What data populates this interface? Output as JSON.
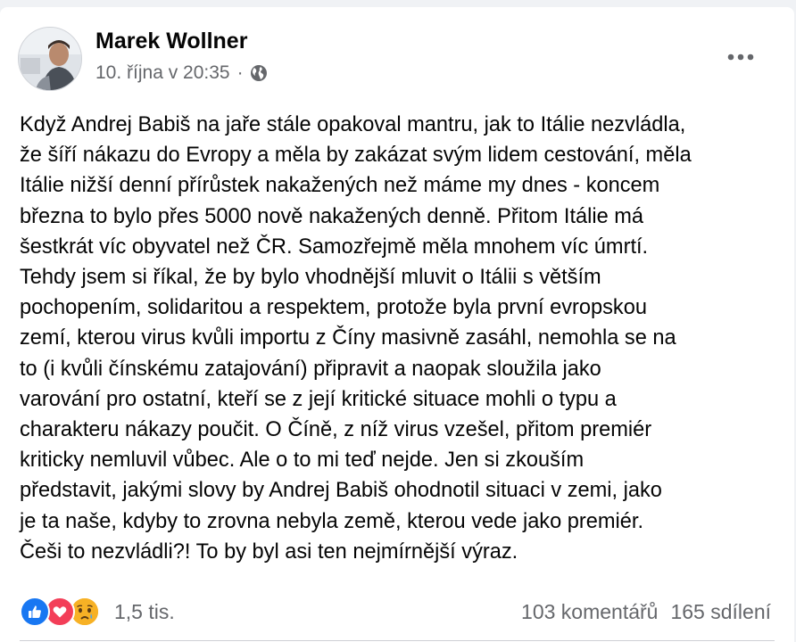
{
  "post": {
    "author": "Marek Wollner",
    "timestamp": "10. října v 20:35",
    "separator": "·",
    "privacy_icon": "globe-icon",
    "more_icon": "more-options-icon",
    "lines": [
      "Když Andrej Babiš na jaře stále opakoval mantru, jak to Itálie nezvládla,",
      "že šíří nákazu do Evropy a měla by zakázat svým lidem cestování, měla",
      "Itálie nižší denní přírůstek nakažených než máme my dnes - koncem",
      "března to bylo přes 5000 nově nakažených denně. Přitom Itálie má",
      "šestkrát víc obyvatel než ČR. Samozřejmě měla mnohem víc úmrtí.",
      "Tehdy jsem si říkal, že by bylo vhodnější mluvit o Itálii s větším",
      "pochopením, solidaritou a respektem, protože byla první evropskou",
      "zemí, kterou virus kvůli importu z Číny masivně zasáhl, nemohla se na",
      "to (i kvůli čínskému zatajování) připravit a naopak sloužila jako",
      "varování pro ostatní, kteří se z její kritické situace mohli o typu a",
      "charakteru nákazy poučit. O Číně, z níž virus vzešel, přitom premiér",
      "kriticky nemluvil vůbec. Ale o to mi teď nejde. Jen si zkouším",
      "představit, jakými slovy by Andrej Babiš ohodnotil situaci v zemi, jako",
      "je ta naše, kdyby to zrovna nebyla země, kterou vede jako premiér.",
      "Češi to nezvládli?! To by byl asi ten nejmírnější výraz."
    ]
  },
  "reactions": {
    "icons": [
      "like-icon",
      "love-icon",
      "sad-icon"
    ],
    "count": "1,5 tis."
  },
  "stats": {
    "comments": "103 komentářů",
    "shares": "165 sdílení"
  },
  "colors": {
    "like": "#1877f2",
    "love": "#f33e58",
    "sad": "#f7b125",
    "secondary_text": "#65676b",
    "primary_text": "#050505"
  }
}
